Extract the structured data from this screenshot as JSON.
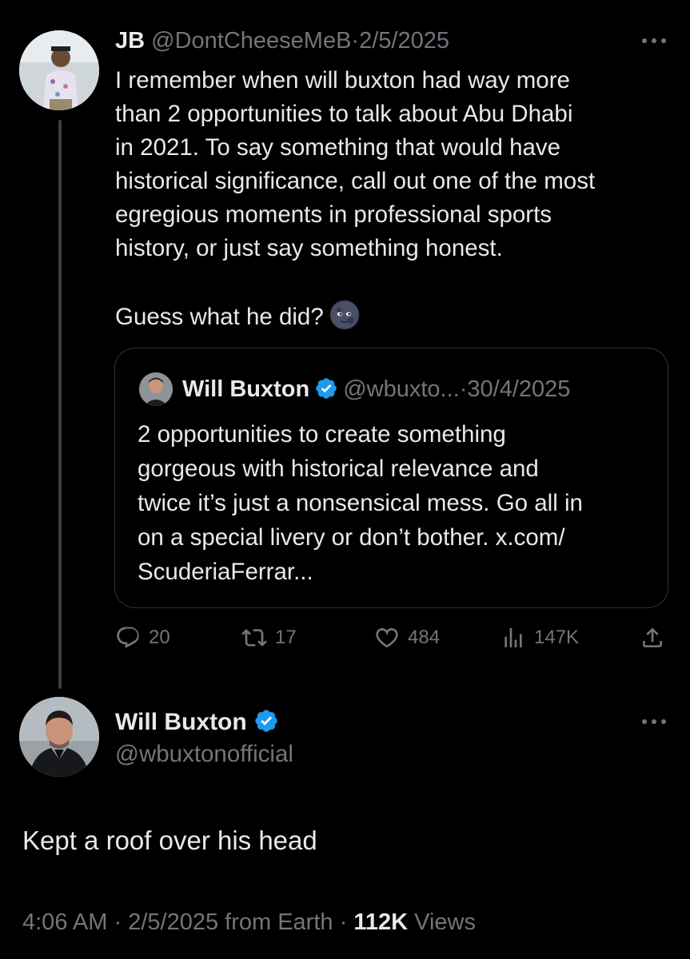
{
  "reply": {
    "display_name": "JB",
    "handle": "@DontCheeseMeB",
    "separator": "·",
    "date": "2/5/2025",
    "paragraph1": "I remember when will buxton had way more\nthan 2 opportunities to talk about Abu Dhabi\nin 2021. To say something that would have\nhistorical significance, call out one of the most\negregious moments in professional sports\nhistory, or just say something honest.",
    "paragraph2": "Guess what he did?",
    "emoji_icon": "new-moon-face-icon"
  },
  "quote": {
    "display_name": "Will Buxton",
    "handle": "@wbuxto...",
    "separator": "·",
    "date": "30/4/2025",
    "text": "2 opportunities to create something\ngorgeous with historical relevance and\ntwice it’s just a nonsensical mess. Go all in\non a special livery or don’t bother. x.com/\nScuderiaFerrar..."
  },
  "actions": {
    "replies": "20",
    "reposts": "17",
    "likes": "484",
    "views": "147K"
  },
  "main": {
    "display_name": "Will Buxton",
    "handle": "@wbuxtonofficial",
    "text": "Kept a roof over his head",
    "time": "4:06 AM",
    "separator": "·",
    "date": "2/5/2025",
    "source": "from Earth",
    "views_count": "112K",
    "views_label": "Views"
  },
  "colors": {
    "background": "#000000",
    "text": "#e7e9ea",
    "muted": "#71767b",
    "verified": "#1d9bf0",
    "border": "#2f3336"
  }
}
